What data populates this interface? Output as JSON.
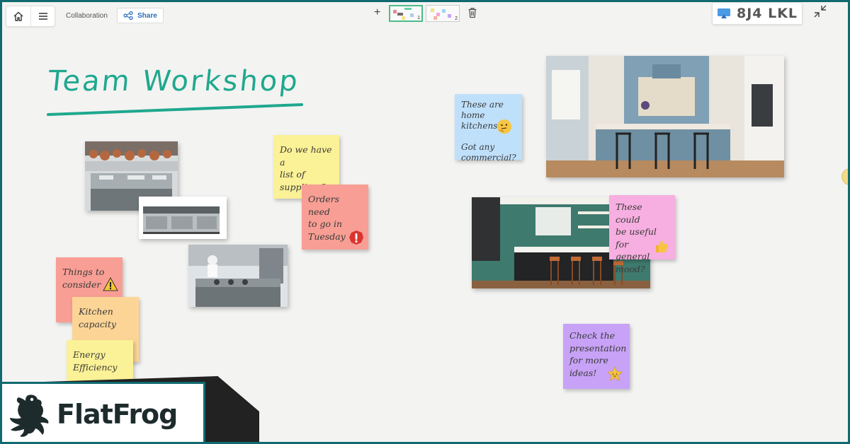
{
  "toolbar": {
    "collaboration_label": "Collaboration",
    "share_label": "Share",
    "add_page_label": "+",
    "pages": [
      {
        "number": "1",
        "active": true
      },
      {
        "number": "2",
        "active": false
      }
    ],
    "cast_code": "8J4 LKL"
  },
  "board": {
    "title": "Team Workshop",
    "notes": [
      {
        "id": "suppliers",
        "text": "Do we have a\nlist of\nsuppliers?",
        "color": "#fbf196",
        "icon": ""
      },
      {
        "id": "orders",
        "text": "Orders need\nto go in\nTuesday",
        "color": "#f89e94",
        "icon": "exclamation-icon"
      },
      {
        "id": "things",
        "text": "Things to\nconsider",
        "color": "#f89e94",
        "icon": "warning-icon"
      },
      {
        "id": "kitchen-capacity",
        "text": "Kitchen\ncapacity",
        "color": "#fcd596",
        "icon": ""
      },
      {
        "id": "energy",
        "text": "Energy\nEfficiency",
        "color": "#fbf196",
        "icon": ""
      },
      {
        "id": "home-kitchens",
        "text": "These are home\nkitchens?\n\nGot any\ncommercial?",
        "color": "#bfe0fb",
        "icon": "thinking-face-icon"
      },
      {
        "id": "general-mood",
        "text": "These could\nbe useful for\ngeneral\nmood?",
        "color": "#f7aee0",
        "icon": "thumbs-up-icon"
      },
      {
        "id": "presentation",
        "text": "Check the\npresentation\nfor more\nideas!",
        "color": "#c7a2f6",
        "icon": "star-icon"
      }
    ],
    "images": [
      {
        "id": "commercial-kitchen-copper",
        "subject": "commercial kitchen with hanging copper pots"
      },
      {
        "id": "steel-range",
        "subject": "stainless steel cooking range"
      },
      {
        "id": "chef-kitchen",
        "subject": "chefs in professional steel kitchen"
      },
      {
        "id": "blue-home-kitchen",
        "subject": "blue kitchen island with bar stools"
      },
      {
        "id": "green-home-kitchen",
        "subject": "green kitchen with black island and copper stools"
      }
    ]
  },
  "brand": {
    "name": "FlatFrog"
  },
  "colors": {
    "frame": "#106a70",
    "title": "#1fa88e",
    "share_text": "#2a6fb8"
  }
}
